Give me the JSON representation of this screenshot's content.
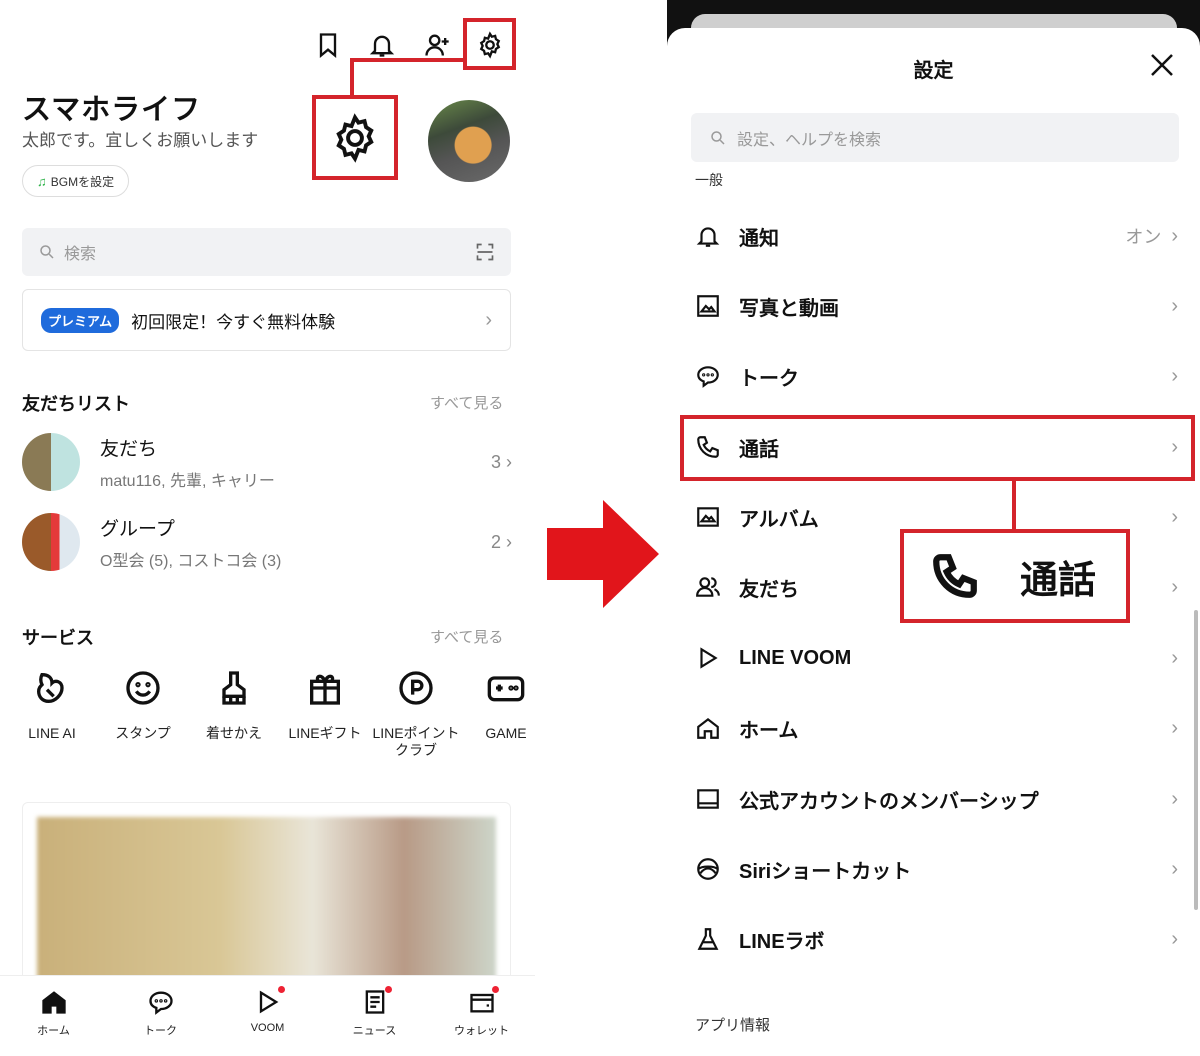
{
  "left": {
    "profile": {
      "name": "スマホライフ",
      "status": "太郎です。宜しくお願いします",
      "bgm_button": "BGMを設定"
    },
    "search_placeholder": "検索",
    "premium": {
      "badge": "プレミアム",
      "text": "初回限定！今すぐ無料体験"
    },
    "friends_section": {
      "title": "友だちリスト",
      "see_all": "すべて見る",
      "rows": [
        {
          "name": "友だち",
          "sub": "matu116, 先輩, キャリー",
          "count": "3"
        },
        {
          "name": "グループ",
          "sub": "O型会 (5), コストコ会 (3)",
          "count": "2"
        }
      ]
    },
    "services_section": {
      "title": "サービス",
      "see_all": "すべて見る",
      "items": [
        {
          "label": "LINE AI",
          "icon": "line-ai-icon"
        },
        {
          "label": "スタンプ",
          "icon": "smile-icon"
        },
        {
          "label": "着せかえ",
          "icon": "brush-icon"
        },
        {
          "label": "LINEギフト",
          "icon": "gift-icon"
        },
        {
          "label": "LINEポイントクラブ",
          "icon": "points-icon"
        },
        {
          "label": "GAME",
          "icon": "gamepad-icon"
        }
      ]
    },
    "tabs": [
      {
        "label": "ホーム",
        "icon": "home-icon",
        "dot": false
      },
      {
        "label": "トーク",
        "icon": "chat-icon",
        "dot": false
      },
      {
        "label": "VOOM",
        "icon": "voom-icon",
        "dot": true
      },
      {
        "label": "ニュース",
        "icon": "news-icon",
        "dot": true
      },
      {
        "label": "ウォレット",
        "icon": "wallet-icon",
        "dot": true
      }
    ]
  },
  "right": {
    "title": "設定",
    "search_placeholder": "設定、ヘルプを検索",
    "general_header": "一般",
    "rows": [
      {
        "label": "通知",
        "value": "オン",
        "icon": "bell-icon"
      },
      {
        "label": "写真と動画",
        "icon": "photo-icon"
      },
      {
        "label": "トーク",
        "icon": "chat-bubble-icon"
      },
      {
        "label": "通話",
        "icon": "phone-icon"
      },
      {
        "label": "アルバム",
        "icon": "album-icon"
      },
      {
        "label": "友だち",
        "icon": "friends-icon"
      },
      {
        "label": "LINE VOOM",
        "icon": "voom-icon"
      },
      {
        "label": "ホーム",
        "icon": "home-icon"
      },
      {
        "label": "公式アカウントのメンバーシップ",
        "icon": "membership-icon"
      },
      {
        "label": "Siriショートカット",
        "icon": "siri-icon"
      },
      {
        "label": "LINEラボ",
        "icon": "flask-icon"
      }
    ],
    "app_info_header": "アプリ情報",
    "callout_label": "通話"
  },
  "accent_color": "#d4242b"
}
